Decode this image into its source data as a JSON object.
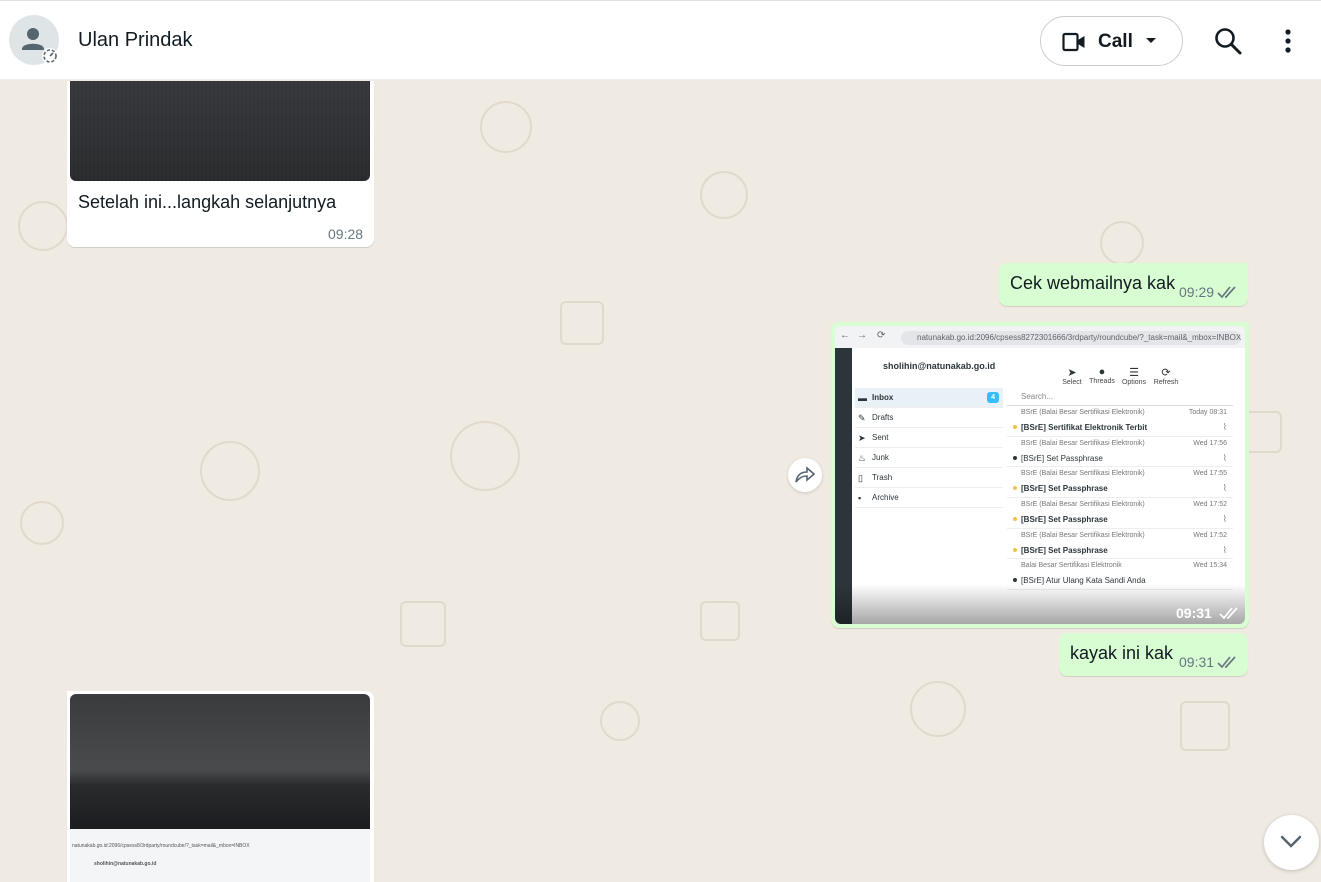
{
  "header": {
    "contact_name": "Ulan Prindak",
    "call_label": "Call"
  },
  "messages": [
    {
      "direction": "in",
      "type": "image",
      "caption": "Setelah ini...langkah selanjutnya",
      "time": "09:28"
    },
    {
      "direction": "out",
      "type": "text",
      "text": "Cek webmailnya kak",
      "time": "09:29",
      "status": "read"
    },
    {
      "direction": "out",
      "type": "image",
      "time": "09:31",
      "status": "read"
    },
    {
      "direction": "out",
      "type": "text",
      "text": "kayak ini kak",
      "time": "09:31",
      "status": "read"
    },
    {
      "direction": "in",
      "type": "image"
    }
  ],
  "webmail_screenshot": {
    "url": "natunakab.go.id:2096/cpsess8272301666/3rdparty/roundcube/?_task=mail&_mbox=INBOX",
    "account": "sholihin@natunakab.go.id",
    "toolbar": [
      "Select",
      "Threads",
      "Options",
      "Refresh"
    ],
    "folders": [
      {
        "name": "Inbox",
        "badge": "4"
      },
      {
        "name": "Drafts"
      },
      {
        "name": "Sent"
      },
      {
        "name": "Junk"
      },
      {
        "name": "Trash"
      },
      {
        "name": "Archive"
      }
    ],
    "search_placeholder": "Search...",
    "emails": [
      {
        "from": "BSrE (Balai Besar Sertifikasi Elektronik)",
        "date": "Today 08:31",
        "subject": "[BSrE] Sertifikat Elektronik Terbit",
        "unread": true
      },
      {
        "from": "BSrE (Balai Besar Sertifikasi Elektronik)",
        "date": "Wed 17:56",
        "subject": "[BSrE] Set Passphrase",
        "unread": false
      },
      {
        "from": "BSrE (Balai Besar Sertifikasi Elektronik)",
        "date": "Wed 17:55",
        "subject": "[BSrE] Set Passphrase",
        "unread": true
      },
      {
        "from": "BSrE (Balai Besar Sertifikasi Elektronik)",
        "date": "Wed 17:52",
        "subject": "[BSrE] Set Passphrase",
        "unread": true
      },
      {
        "from": "BSrE (Balai Besar Sertifikasi Elektronik)",
        "date": "Wed 17:52",
        "subject": "[BSrE] Set Passphrase",
        "unread": true
      },
      {
        "from": "Balai Besar Sertifikasi Elektronik",
        "date": "Wed 15:34",
        "subject": "[BSrE] Atur Ulang Kata Sandi Anda",
        "unread": false
      }
    ]
  },
  "bottom_photo": {
    "url_text": "natunakab.go.id:2096/cpsess8/3rdparty/roundcube/?_task=mail&_mbox=INBOX",
    "account": "sholihin@natunakab.go.id"
  },
  "colors": {
    "chat_bg": "#efeae2",
    "incoming_bubble": "#ffffff",
    "outgoing_bubble": "#d9fdd3",
    "read_ticks": "#667781"
  }
}
